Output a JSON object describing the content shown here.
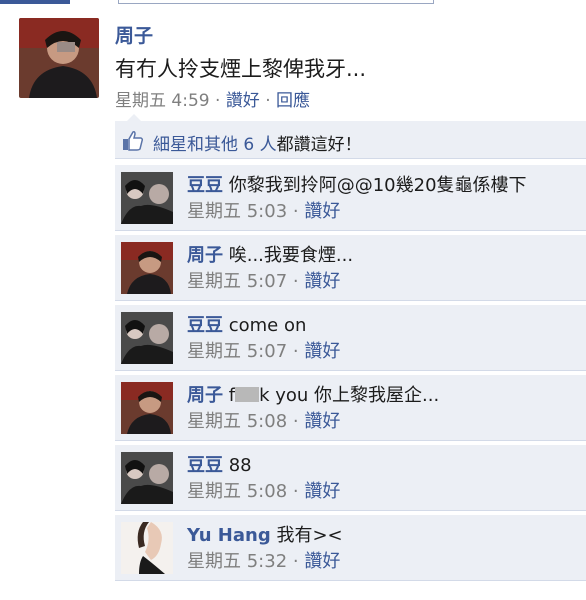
{
  "post": {
    "author": "周子",
    "text": "有冇人拎支煙上黎俾我牙...",
    "time": "星期五 4:59",
    "sep1": " · ",
    "like_label": "讚好",
    "sep2": " · ",
    "reply_label": "回應"
  },
  "likes": {
    "names": "細星和其他 6 人",
    "suffix": "都讚這好！"
  },
  "comments": [
    {
      "author": "豆豆",
      "text": "你黎我到拎阿@@10幾20隻龜係樓下",
      "time": "星期五 5:03",
      "like_label": "讚好"
    },
    {
      "author": "周子",
      "text": "唉...我要食煙...",
      "time": "星期五 5:07",
      "like_label": "讚好"
    },
    {
      "author": "豆豆",
      "text": "come on",
      "time": "星期五 5:07",
      "like_label": "讚好"
    },
    {
      "author": "周子",
      "text_prefix": "f",
      "text_suffix": "k you 你上黎我屋企...",
      "time": "星期五 5:08",
      "like_label": "讚好"
    },
    {
      "author": "豆豆",
      "text": "88",
      "time": "星期五 5:08",
      "like_label": "讚好"
    },
    {
      "author": "Yu Hang",
      "text": "我有><",
      "time": "星期五 5:32",
      "like_label": "讚好"
    }
  ],
  "colors": {
    "link": "#3b5998",
    "meta": "#7f7f7f",
    "comment_bg": "#eceff5"
  }
}
